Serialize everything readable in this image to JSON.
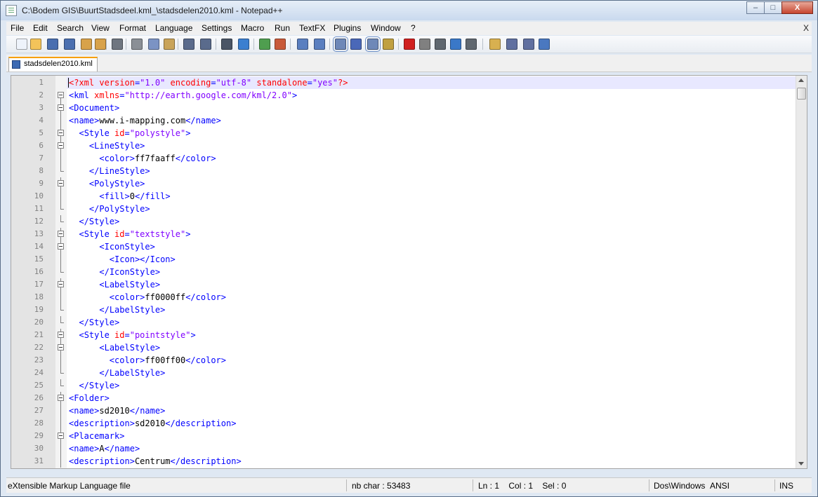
{
  "window": {
    "title": "C:\\Bodem GIS\\BuurtStadsdeel.kml_\\stadsdelen2010.kml - Notepad++",
    "controls": {
      "minimize": "–",
      "maximize": "□",
      "close": "X"
    }
  },
  "menu": {
    "items": [
      "File",
      "Edit",
      "Search",
      "View",
      "Format",
      "Language",
      "Settings",
      "Macro",
      "Run",
      "TextFX",
      "Plugins",
      "Window",
      "?"
    ],
    "close_label": "X"
  },
  "toolbar": {
    "icons": [
      "new-file-icon",
      "open-file-icon",
      "save-icon",
      "save-all-icon",
      "close-icon",
      "close-all-icon",
      "print-icon",
      "cut-icon",
      "copy-icon",
      "paste-icon",
      "undo-icon",
      "redo-icon",
      "find-icon",
      "replace-icon",
      "zoom-in-icon",
      "zoom-out-icon",
      "sync-vertical-icon",
      "sync-horizontal-icon",
      "word-wrap-icon",
      "show-all-chars-icon",
      "indent-guide-icon",
      "doc-map-icon",
      "record-macro-icon",
      "stop-macro-icon",
      "play-macro-icon",
      "run-macro-multiple-icon",
      "save-macro-icon",
      "folder-icon",
      "console-icon",
      "function-list-icon",
      "spell-check-icon"
    ]
  },
  "tabs": [
    {
      "label": "stadsdelen2010.kml",
      "active": true
    }
  ],
  "editor": {
    "current_line": 1,
    "lines": [
      {
        "n": "1",
        "i": 0,
        "f": null,
        "tok": [
          [
            "d",
            "<?xml "
          ],
          [
            "a",
            "version"
          ],
          [
            "p",
            "="
          ],
          [
            "v",
            "\"1.0\""
          ],
          [
            "p",
            " "
          ],
          [
            "a",
            "encoding"
          ],
          [
            "p",
            "="
          ],
          [
            "v",
            "\"utf-8\""
          ],
          [
            "p",
            " "
          ],
          [
            "a",
            "standalone"
          ],
          [
            "p",
            "="
          ],
          [
            "v",
            "\"yes\""
          ],
          [
            "d",
            "?>"
          ]
        ]
      },
      {
        "n": "2",
        "i": 0,
        "f": "open",
        "tok": [
          [
            "p",
            "<"
          ],
          [
            "t",
            "kml"
          ],
          [
            "p",
            " "
          ],
          [
            "a",
            "xmlns"
          ],
          [
            "p",
            "="
          ],
          [
            "v",
            "\"http://earth.google.com/kml/2.0\""
          ],
          [
            "p",
            ">"
          ]
        ]
      },
      {
        "n": "3",
        "i": 0,
        "f": "open",
        "tok": [
          [
            "p",
            "<"
          ],
          [
            "t",
            "Document"
          ],
          [
            "p",
            ">"
          ]
        ]
      },
      {
        "n": "4",
        "i": 0,
        "f": "line",
        "tok": [
          [
            "p",
            "<"
          ],
          [
            "t",
            "name"
          ],
          [
            "p",
            ">"
          ],
          [
            "x",
            "www.i-mapping.com"
          ],
          [
            "p",
            "</"
          ],
          [
            "t",
            "name"
          ],
          [
            "p",
            ">"
          ]
        ]
      },
      {
        "n": "5",
        "i": 2,
        "f": "open",
        "tok": [
          [
            "p",
            "<"
          ],
          [
            "t",
            "Style"
          ],
          [
            "p",
            " "
          ],
          [
            "a",
            "id"
          ],
          [
            "p",
            "="
          ],
          [
            "v",
            "\"polystyle\""
          ],
          [
            "p",
            ">"
          ]
        ]
      },
      {
        "n": "6",
        "i": 4,
        "f": "open",
        "tok": [
          [
            "p",
            "<"
          ],
          [
            "t",
            "LineStyle"
          ],
          [
            "p",
            ">"
          ]
        ]
      },
      {
        "n": "7",
        "i": 6,
        "f": "line",
        "tok": [
          [
            "p",
            "<"
          ],
          [
            "t",
            "color"
          ],
          [
            "p",
            ">"
          ],
          [
            "x",
            "ff7faaff"
          ],
          [
            "p",
            "</"
          ],
          [
            "t",
            "color"
          ],
          [
            "p",
            ">"
          ]
        ]
      },
      {
        "n": "8",
        "i": 4,
        "f": "end",
        "tok": [
          [
            "p",
            "</"
          ],
          [
            "t",
            "LineStyle"
          ],
          [
            "p",
            ">"
          ]
        ]
      },
      {
        "n": "9",
        "i": 4,
        "f": "open",
        "tok": [
          [
            "p",
            "<"
          ],
          [
            "t",
            "PolyStyle"
          ],
          [
            "p",
            ">"
          ]
        ]
      },
      {
        "n": "10",
        "i": 6,
        "f": "line",
        "tok": [
          [
            "p",
            "<"
          ],
          [
            "t",
            "fill"
          ],
          [
            "p",
            ">"
          ],
          [
            "x",
            "0"
          ],
          [
            "p",
            "</"
          ],
          [
            "t",
            "fill"
          ],
          [
            "p",
            ">"
          ]
        ]
      },
      {
        "n": "11",
        "i": 4,
        "f": "end",
        "tok": [
          [
            "p",
            "</"
          ],
          [
            "t",
            "PolyStyle"
          ],
          [
            "p",
            ">"
          ]
        ]
      },
      {
        "n": "12",
        "i": 2,
        "f": "end",
        "tok": [
          [
            "p",
            "</"
          ],
          [
            "t",
            "Style"
          ],
          [
            "p",
            ">"
          ]
        ]
      },
      {
        "n": "13",
        "i": 2,
        "f": "open",
        "tok": [
          [
            "p",
            "<"
          ],
          [
            "t",
            "Style"
          ],
          [
            "p",
            " "
          ],
          [
            "a",
            "id"
          ],
          [
            "p",
            "="
          ],
          [
            "v",
            "\"textstyle\""
          ],
          [
            "p",
            ">"
          ]
        ]
      },
      {
        "n": "14",
        "i": 6,
        "f": "open",
        "tok": [
          [
            "p",
            "<"
          ],
          [
            "t",
            "IconStyle"
          ],
          [
            "p",
            ">"
          ]
        ]
      },
      {
        "n": "15",
        "i": 8,
        "f": "line",
        "tok": [
          [
            "p",
            "<"
          ],
          [
            "t",
            "Icon"
          ],
          [
            "p",
            "></"
          ],
          [
            "t",
            "Icon"
          ],
          [
            "p",
            ">"
          ]
        ]
      },
      {
        "n": "16",
        "i": 6,
        "f": "end",
        "tok": [
          [
            "p",
            "</"
          ],
          [
            "t",
            "IconStyle"
          ],
          [
            "p",
            ">"
          ]
        ]
      },
      {
        "n": "17",
        "i": 6,
        "f": "open",
        "tok": [
          [
            "p",
            "<"
          ],
          [
            "t",
            "LabelStyle"
          ],
          [
            "p",
            ">"
          ]
        ]
      },
      {
        "n": "18",
        "i": 8,
        "f": "line",
        "tok": [
          [
            "p",
            "<"
          ],
          [
            "t",
            "color"
          ],
          [
            "p",
            ">"
          ],
          [
            "x",
            "ff0000ff"
          ],
          [
            "p",
            "</"
          ],
          [
            "t",
            "color"
          ],
          [
            "p",
            ">"
          ]
        ]
      },
      {
        "n": "19",
        "i": 6,
        "f": "end",
        "tok": [
          [
            "p",
            "</"
          ],
          [
            "t",
            "LabelStyle"
          ],
          [
            "p",
            ">"
          ]
        ]
      },
      {
        "n": "20",
        "i": 2,
        "f": "end",
        "tok": [
          [
            "p",
            "</"
          ],
          [
            "t",
            "Style"
          ],
          [
            "p",
            ">"
          ]
        ]
      },
      {
        "n": "21",
        "i": 2,
        "f": "open",
        "tok": [
          [
            "p",
            "<"
          ],
          [
            "t",
            "Style"
          ],
          [
            "p",
            " "
          ],
          [
            "a",
            "id"
          ],
          [
            "p",
            "="
          ],
          [
            "v",
            "\"pointstyle\""
          ],
          [
            "p",
            ">"
          ]
        ]
      },
      {
        "n": "22",
        "i": 6,
        "f": "open",
        "tok": [
          [
            "p",
            "<"
          ],
          [
            "t",
            "LabelStyle"
          ],
          [
            "p",
            ">"
          ]
        ]
      },
      {
        "n": "23",
        "i": 8,
        "f": "line",
        "tok": [
          [
            "p",
            "<"
          ],
          [
            "t",
            "color"
          ],
          [
            "p",
            ">"
          ],
          [
            "x",
            "ff00ff00"
          ],
          [
            "p",
            "</"
          ],
          [
            "t",
            "color"
          ],
          [
            "p",
            ">"
          ]
        ]
      },
      {
        "n": "24",
        "i": 6,
        "f": "end",
        "tok": [
          [
            "p",
            "</"
          ],
          [
            "t",
            "LabelStyle"
          ],
          [
            "p",
            ">"
          ]
        ]
      },
      {
        "n": "25",
        "i": 2,
        "f": "end",
        "tok": [
          [
            "p",
            "</"
          ],
          [
            "t",
            "Style"
          ],
          [
            "p",
            ">"
          ]
        ]
      },
      {
        "n": "26",
        "i": 0,
        "f": "open",
        "tok": [
          [
            "p",
            "<"
          ],
          [
            "t",
            "Folder"
          ],
          [
            "p",
            ">"
          ]
        ]
      },
      {
        "n": "27",
        "i": 0,
        "f": "line",
        "tok": [
          [
            "p",
            "<"
          ],
          [
            "t",
            "name"
          ],
          [
            "p",
            ">"
          ],
          [
            "x",
            "sd2010"
          ],
          [
            "p",
            "</"
          ],
          [
            "t",
            "name"
          ],
          [
            "p",
            ">"
          ]
        ]
      },
      {
        "n": "28",
        "i": 0,
        "f": "line",
        "tok": [
          [
            "p",
            "<"
          ],
          [
            "t",
            "description"
          ],
          [
            "p",
            ">"
          ],
          [
            "x",
            "sd2010"
          ],
          [
            "p",
            "</"
          ],
          [
            "t",
            "description"
          ],
          [
            "p",
            ">"
          ]
        ]
      },
      {
        "n": "29",
        "i": 0,
        "f": "open",
        "tok": [
          [
            "p",
            "<"
          ],
          [
            "t",
            "Placemark"
          ],
          [
            "p",
            ">"
          ]
        ]
      },
      {
        "n": "30",
        "i": 0,
        "f": "line",
        "tok": [
          [
            "p",
            "<"
          ],
          [
            "t",
            "name"
          ],
          [
            "p",
            ">"
          ],
          [
            "x",
            "A"
          ],
          [
            "p",
            "</"
          ],
          [
            "t",
            "name"
          ],
          [
            "p",
            ">"
          ]
        ]
      },
      {
        "n": "31",
        "i": 0,
        "f": "line",
        "tok": [
          [
            "p",
            "<"
          ],
          [
            "t",
            "description"
          ],
          [
            "p",
            ">"
          ],
          [
            "x",
            "Centrum"
          ],
          [
            "p",
            "</"
          ],
          [
            "t",
            "description"
          ],
          [
            "p",
            ">"
          ]
        ]
      }
    ]
  },
  "status": {
    "file_type": "eXtensible Markup Language file",
    "nb_char": "nb char : 53483",
    "position": "Ln : 1    Col : 1    Sel : 0",
    "eol": "Dos\\Windows",
    "encoding": "ANSI",
    "mode": "INS"
  },
  "colors": {
    "tag": "#0000ff",
    "attribute": "#ff0000",
    "value": "#8000ff",
    "text": "#000000",
    "current_line": "#e8e8ff",
    "tab_accent": "#f7a000"
  }
}
